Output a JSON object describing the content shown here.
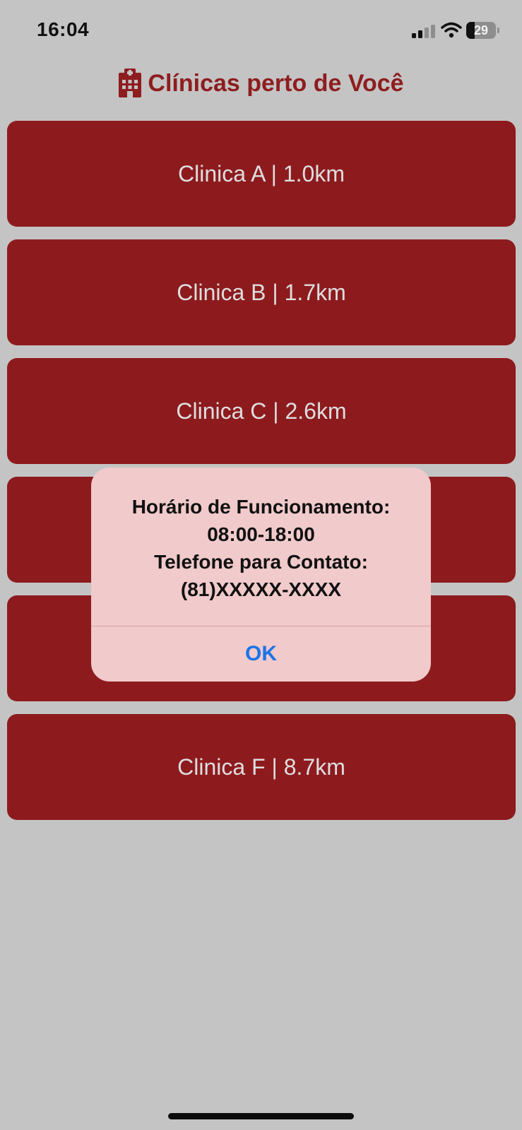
{
  "status_bar": {
    "time": "16:04",
    "battery_level": "29",
    "icons": {
      "signal": "cellular-signal-icon",
      "wifi": "wifi-icon",
      "battery": "battery-icon"
    }
  },
  "header": {
    "icon": "hospital-icon",
    "title": "Clínicas perto de Você",
    "title_color": "#8e1d1f"
  },
  "clinics": [
    {
      "label": "Clinica A | 1.0km"
    },
    {
      "label": "Clinica B | 1.7km"
    },
    {
      "label": "Clinica C | 2.6km"
    },
    {
      "label": ""
    },
    {
      "label": ""
    },
    {
      "label": "Clinica F | 8.7km"
    }
  ],
  "alert": {
    "lines": [
      "Horário de Funcionamento:",
      "08:00-18:00",
      "Telefone para Contato:",
      "(81)XXXXX-XXXX"
    ],
    "ok_label": "OK"
  },
  "colors": {
    "background": "#c4c4c4",
    "button": "#8d1b1e",
    "alert_background": "#f1cacb",
    "link_blue": "#1b74e8"
  }
}
